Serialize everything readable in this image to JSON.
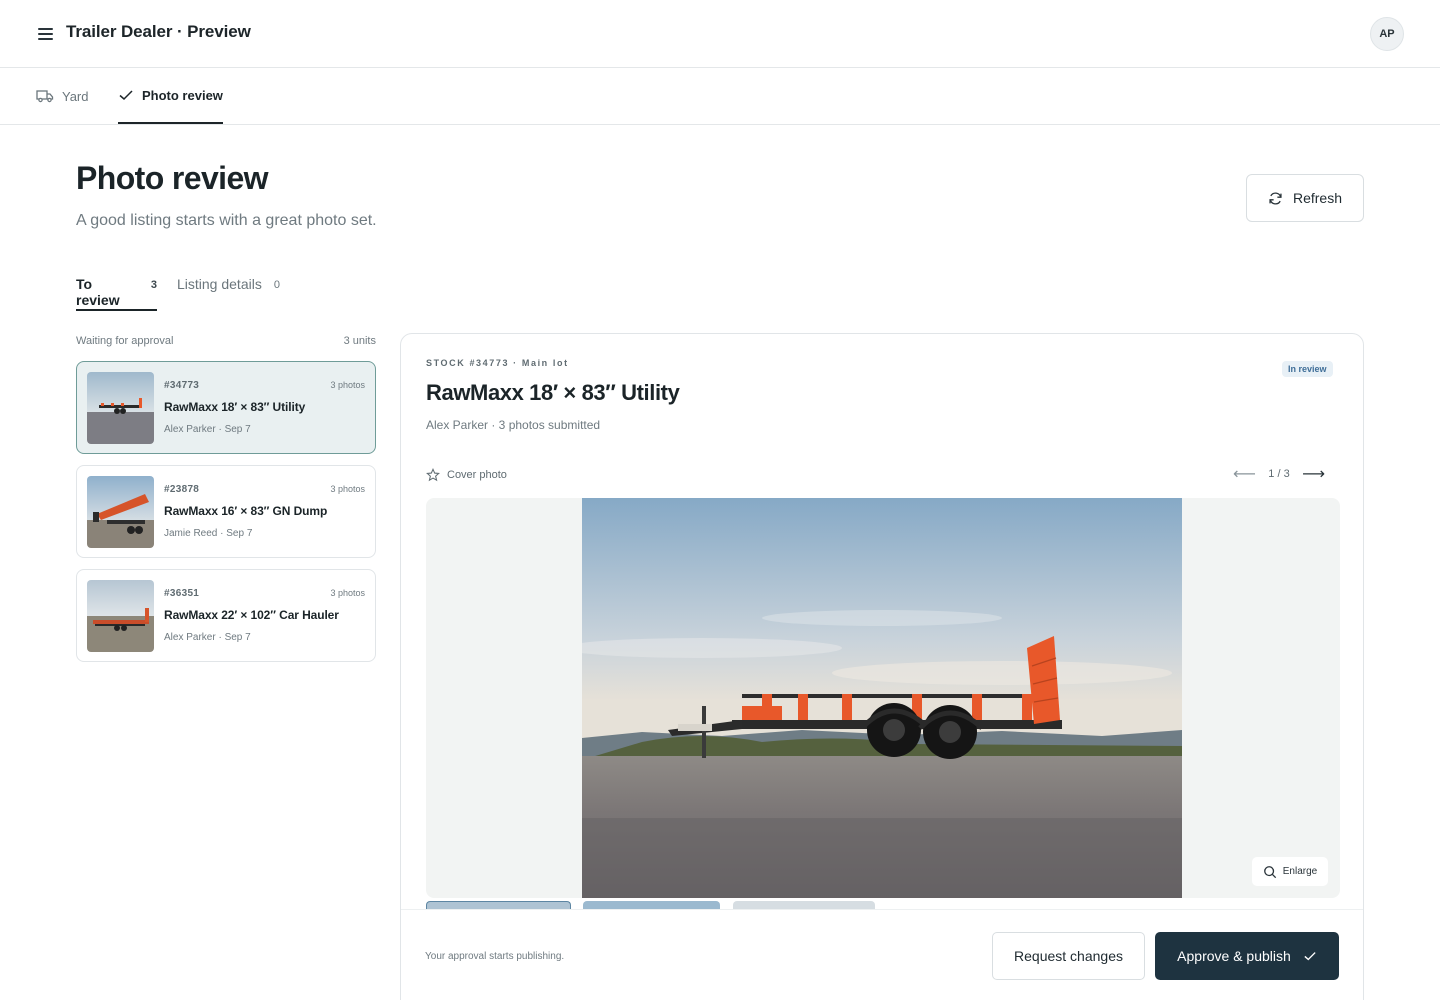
{
  "app": {
    "title": "Trailer Dealer · Preview",
    "avatar_initials": "AP"
  },
  "nav": {
    "tabs": [
      {
        "label": "Yard",
        "icon": "truck-icon",
        "active": false
      },
      {
        "label": "Photo review",
        "icon": "check-icon",
        "active": true
      }
    ]
  },
  "page": {
    "title": "Photo review",
    "subtitle": "A good listing starts with a great photo set.",
    "refresh_label": "Refresh"
  },
  "subtabs": [
    {
      "label": "To review",
      "count": "3",
      "active": true
    },
    {
      "label": "Listing details",
      "count": "0",
      "active": false
    }
  ],
  "list": {
    "heading": "Waiting for approval",
    "count_label": "3 units",
    "items": [
      {
        "stock": "#34773",
        "photos": "3 photos",
        "name": "RawMaxx 18′ × 83″ Utility",
        "meta": "Alex Parker · Sep 7",
        "selected": true
      },
      {
        "stock": "#23878",
        "photos": "3 photos",
        "name": "RawMaxx 16′ × 83″ GN Dump",
        "meta": "Jamie Reed · Sep 7",
        "selected": false
      },
      {
        "stock": "#36351",
        "photos": "3 photos",
        "name": "RawMaxx 22′ × 102″ Car Hauler",
        "meta": "Alex Parker · Sep 7",
        "selected": false
      }
    ]
  },
  "detail": {
    "stock_line": "STOCK #34773 · Main lot",
    "status": "In review",
    "title": "RawMaxx 18′ × 83″ Utility",
    "meta": "Alex Parker · 3 photos submitted",
    "cover_label": "Cover photo",
    "pager": "1 / 3",
    "prev_arrow": "⟵",
    "next_arrow": "⟶",
    "enlarge_label": "Enlarge",
    "footer_note": "Your approval starts publishing.",
    "request_changes_label": "Request changes",
    "approve_label": "Approve & publish"
  },
  "colors": {
    "accent": "#1e3340",
    "selected_bg": "#e9f0f1",
    "selected_border": "#6f9c98",
    "trailer_orange": "#e8582a",
    "badge_text": "#3f6e98"
  }
}
